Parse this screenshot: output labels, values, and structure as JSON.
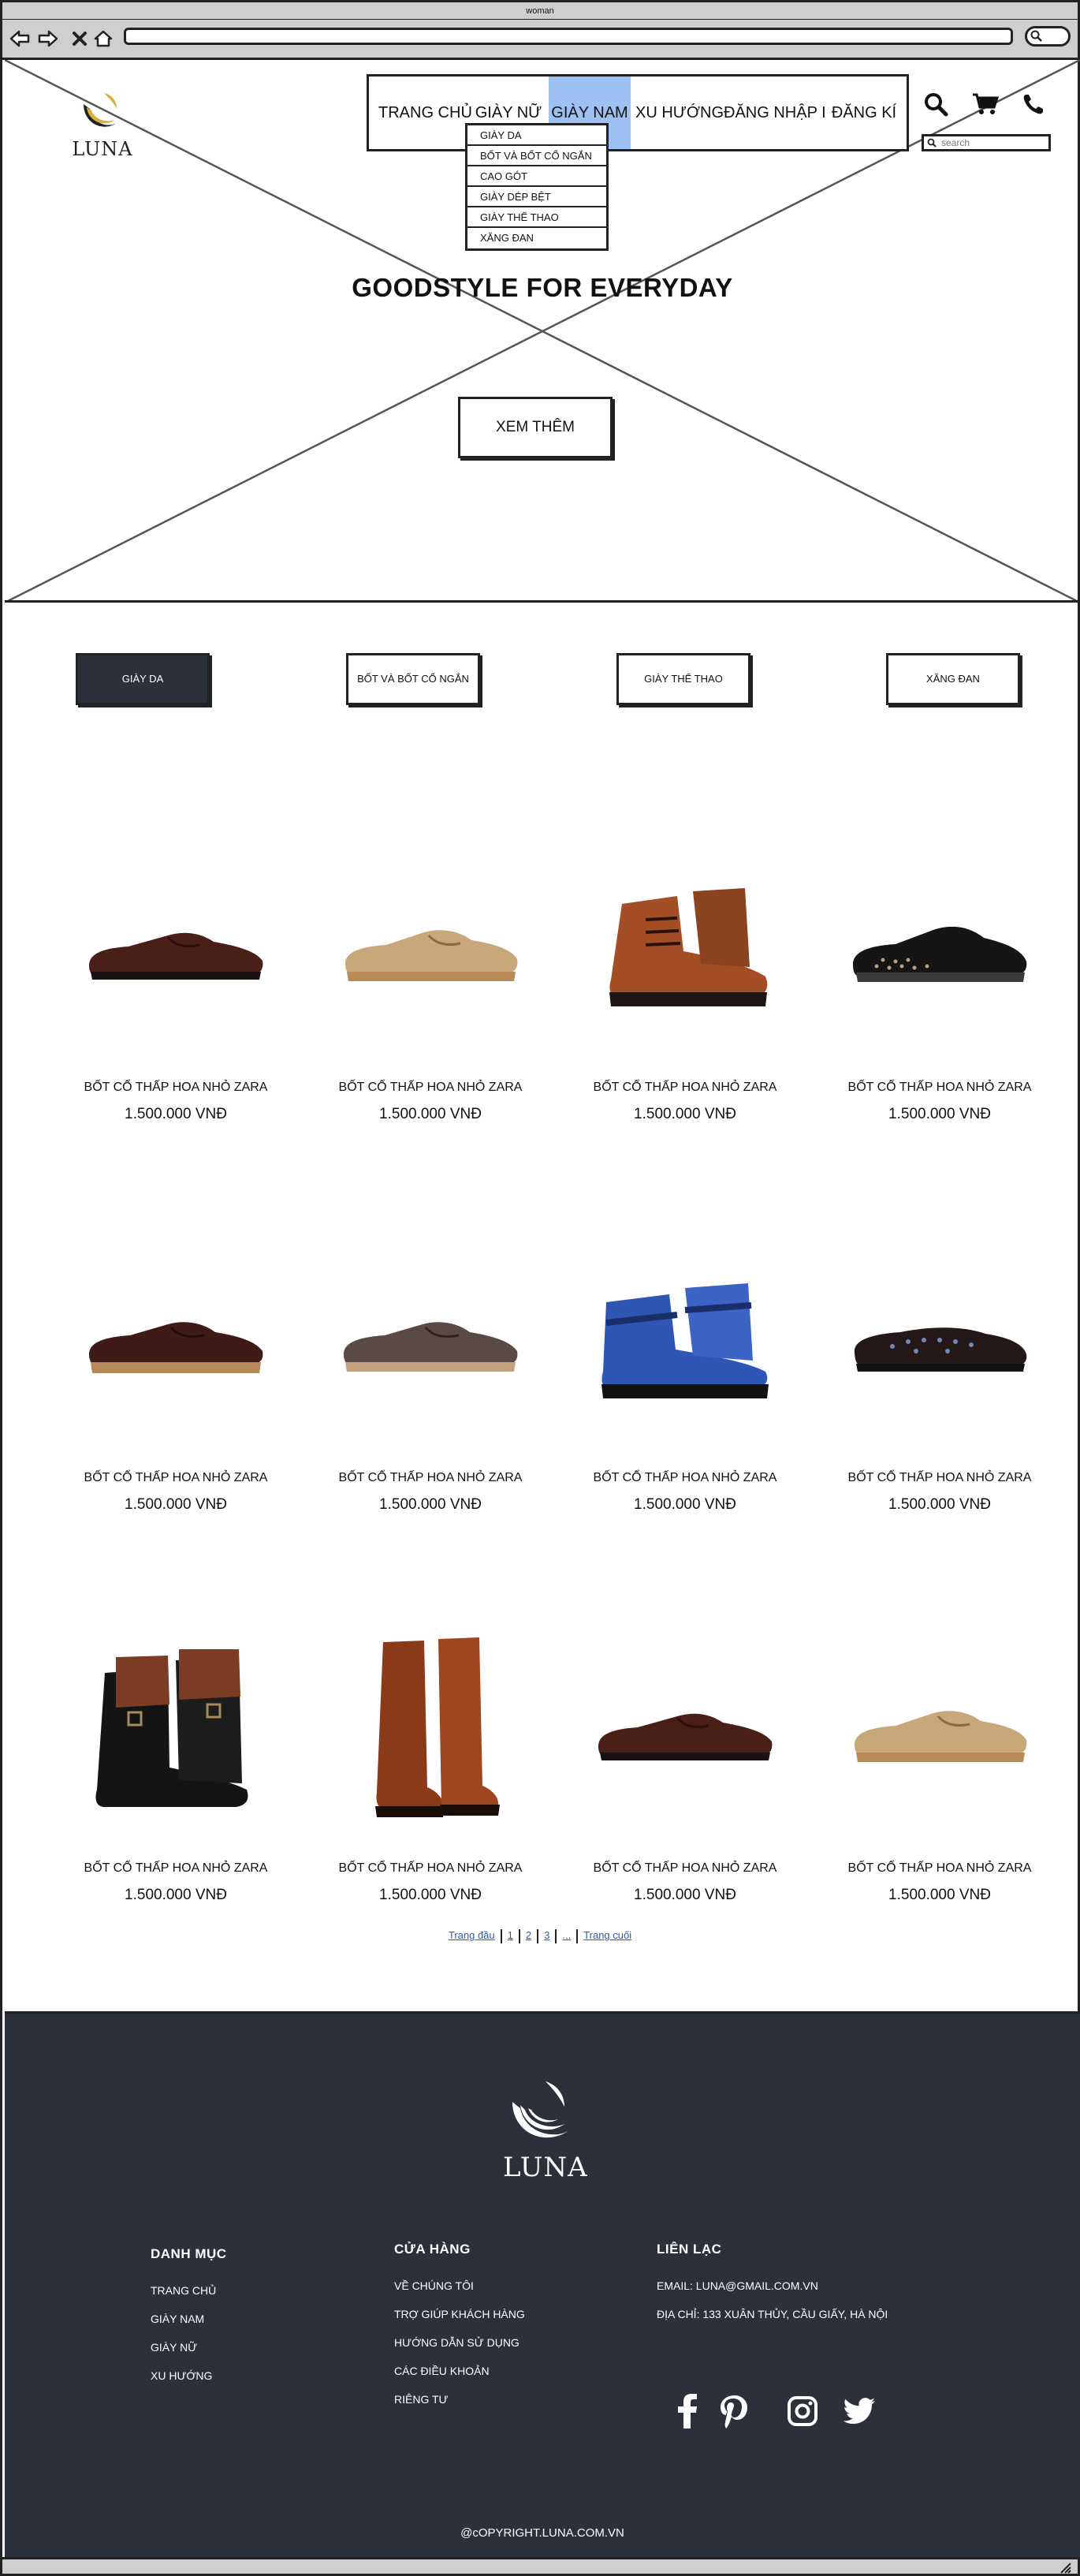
{
  "window": {
    "title": "woman"
  },
  "header": {
    "logo_text": "LUNA",
    "nav": [
      "TRANG CHỦ",
      "GIÀY NỮ",
      "GIÀY NAM",
      "XU HƯỚNG",
      "ĐĂNG NHẬP I",
      "ĐĂNG KÍ"
    ],
    "active_nav": "GIÀY NAM",
    "dropdown": [
      "GIÀY DA",
      "BỐT VÀ BỐT CỔ NGẮN",
      "CAO GÓT",
      "GIÀY DÉP BỆT",
      "GIÀY THỂ THAO",
      "XĂNG ĐAN"
    ],
    "search_placeholder": "search"
  },
  "hero": {
    "tagline": "GOODSTYLE FOR EVERYDAY",
    "cta": "XEM THÊM"
  },
  "categories": [
    {
      "label": "GIÀY DA",
      "active": true
    },
    {
      "label": "BỐT VÀ BỐT CỔ NGẮN",
      "active": false
    },
    {
      "label": "GIÀY THỂ THAO",
      "active": false
    },
    {
      "label": "XĂNG ĐAN",
      "active": false
    }
  ],
  "products": [
    {
      "name": "BỐT CỔ THẤP HOA NHỎ ZARA",
      "price": "1.500.000 VNĐ",
      "image": "brown-oxford"
    },
    {
      "name": "BỐT CỔ THẤP HOA NHỎ ZARA",
      "price": "1.500.000 VNĐ",
      "image": "tan-suede-brogue"
    },
    {
      "name": "BỐT CỔ THẤP HOA NHỎ ZARA",
      "price": "1.500.000 VNĐ",
      "image": "brown-lace-boot"
    },
    {
      "name": "BỐT CỔ THẤP HOA NHỎ ZARA",
      "price": "1.500.000 VNĐ",
      "image": "black-studded-oxford"
    },
    {
      "name": "BỐT CỔ THẤP HOA NHỎ ZARA",
      "price": "1.500.000 VNĐ",
      "image": "dark-brown-brogue"
    },
    {
      "name": "BỐT CỔ THẤP HOA NHỎ ZARA",
      "price": "1.500.000 VNĐ",
      "image": "grey-brown-derby"
    },
    {
      "name": "BỐT CỔ THẤP HOA NHỎ ZARA",
      "price": "1.500.000 VNĐ",
      "image": "blue-high-top-sneaker"
    },
    {
      "name": "BỐT CỔ THẤP HOA NHỎ ZARA",
      "price": "1.500.000 VNĐ",
      "image": "studded-loafer"
    },
    {
      "name": "BỐT CỔ THẤP HOA NHỎ ZARA",
      "price": "1.500.000 VNĐ",
      "image": "black-buckle-boot"
    },
    {
      "name": "BỐT CỔ THẤP HOA NHỎ ZARA",
      "price": "1.500.000 VNĐ",
      "image": "tall-riding-boot"
    },
    {
      "name": "BỐT CỔ THẤP HOA NHỎ ZARA",
      "price": "1.500.000 VNĐ",
      "image": "brown-oxford"
    },
    {
      "name": "BỐT CỔ THẤP HOA NHỎ ZARA",
      "price": "1.500.000 VNĐ",
      "image": "tan-suede-brogue"
    }
  ],
  "pagination": [
    "Trang đầu",
    "1",
    "2",
    "3",
    "...",
    "Trang cuối"
  ],
  "footer": {
    "logo_text": "LUNA",
    "columns": [
      {
        "title": "DANH MỤC",
        "links": [
          "TRANG CHỦ",
          "GIÀY NAM",
          "GIÀY NỮ",
          "XU HƯỚNG"
        ]
      },
      {
        "title": "CỬA HÀNG",
        "links": [
          "VỀ CHÚNG TÔI",
          "TRỢ GIÚP KHÁCH HÀNG",
          "HƯỚNG DẪN SỬ DỤNG",
          "CÁC ĐIỀU KHOẢN",
          "RIÊNG TƯ"
        ]
      },
      {
        "title": "LIÊN LẠC",
        "links": [
          "EMAIL: LUNA@GMAIL.COM.VN",
          "ĐỊA CHỈ: 133 XUÂN THỦY, CẦU GIẤY, HÀ NỘI"
        ]
      }
    ],
    "socials": [
      "facebook-icon",
      "pinterest-icon",
      "instagram-icon",
      "twitter-icon"
    ],
    "copyright": "@cOPYRIGHT.LUNA.COM.VN"
  },
  "colors": {
    "footer_bg": "#2b303b",
    "nav_active": "#9ec1f3",
    "link": "#2a5db0"
  }
}
